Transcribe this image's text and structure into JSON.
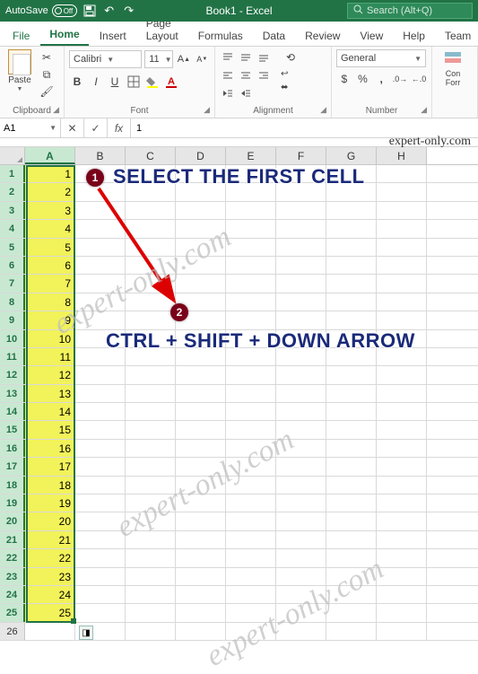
{
  "titlebar": {
    "autosave_label": "AutoSave",
    "autosave_state": "Off",
    "doc_title": "Book1 - Excel",
    "search_placeholder": "Search (Alt+Q)"
  },
  "tabs": [
    "File",
    "Home",
    "Insert",
    "Page Layout",
    "Formulas",
    "Data",
    "Review",
    "View",
    "Help",
    "Team"
  ],
  "active_tab_index": 1,
  "ribbon": {
    "clipboard": {
      "paste": "Paste",
      "label": "Clipboard"
    },
    "font": {
      "name": "Calibri",
      "size": "11",
      "bold": "B",
      "italic": "I",
      "underline": "U",
      "label": "Font"
    },
    "alignment": {
      "wrap": "Wrap Text",
      "merge": "Merge & Center",
      "label": "Alignment"
    },
    "number": {
      "format": "General",
      "label": "Number"
    },
    "cond": {
      "line1": "Con",
      "line2": "Forr"
    }
  },
  "fxbar": {
    "namebox": "A1",
    "formula": "1"
  },
  "top_watermark": "expert-only.com",
  "columns": [
    "A",
    "B",
    "C",
    "D",
    "E",
    "F",
    "G",
    "H"
  ],
  "selected_col_index": 0,
  "rows": [
    {
      "n": 1,
      "v": "1"
    },
    {
      "n": 2,
      "v": "2"
    },
    {
      "n": 3,
      "v": "3"
    },
    {
      "n": 4,
      "v": "4"
    },
    {
      "n": 5,
      "v": "5"
    },
    {
      "n": 6,
      "v": "6"
    },
    {
      "n": 7,
      "v": "7"
    },
    {
      "n": 8,
      "v": "8"
    },
    {
      "n": 9,
      "v": "9"
    },
    {
      "n": 10,
      "v": "10"
    },
    {
      "n": 11,
      "v": "11"
    },
    {
      "n": 12,
      "v": "12"
    },
    {
      "n": 13,
      "v": "13"
    },
    {
      "n": 14,
      "v": "14"
    },
    {
      "n": 15,
      "v": "15"
    },
    {
      "n": 16,
      "v": "16"
    },
    {
      "n": 17,
      "v": "17"
    },
    {
      "n": 18,
      "v": "18"
    },
    {
      "n": 19,
      "v": "19"
    },
    {
      "n": 20,
      "v": "20"
    },
    {
      "n": 21,
      "v": "21"
    },
    {
      "n": 22,
      "v": "22"
    },
    {
      "n": 23,
      "v": "23"
    },
    {
      "n": 24,
      "v": "24"
    },
    {
      "n": 25,
      "v": "25"
    },
    {
      "n": 26,
      "v": ""
    }
  ],
  "selection": {
    "first_row": 1,
    "last_row": 25,
    "col": "A",
    "active_row": 26
  },
  "annotations": {
    "badge1": "1",
    "badge2": "2",
    "text1": "SELECT THE FIRST CELL",
    "text2": "CTRL + SHIFT + DOWN ARROW",
    "watermark": "expert-only.com"
  }
}
